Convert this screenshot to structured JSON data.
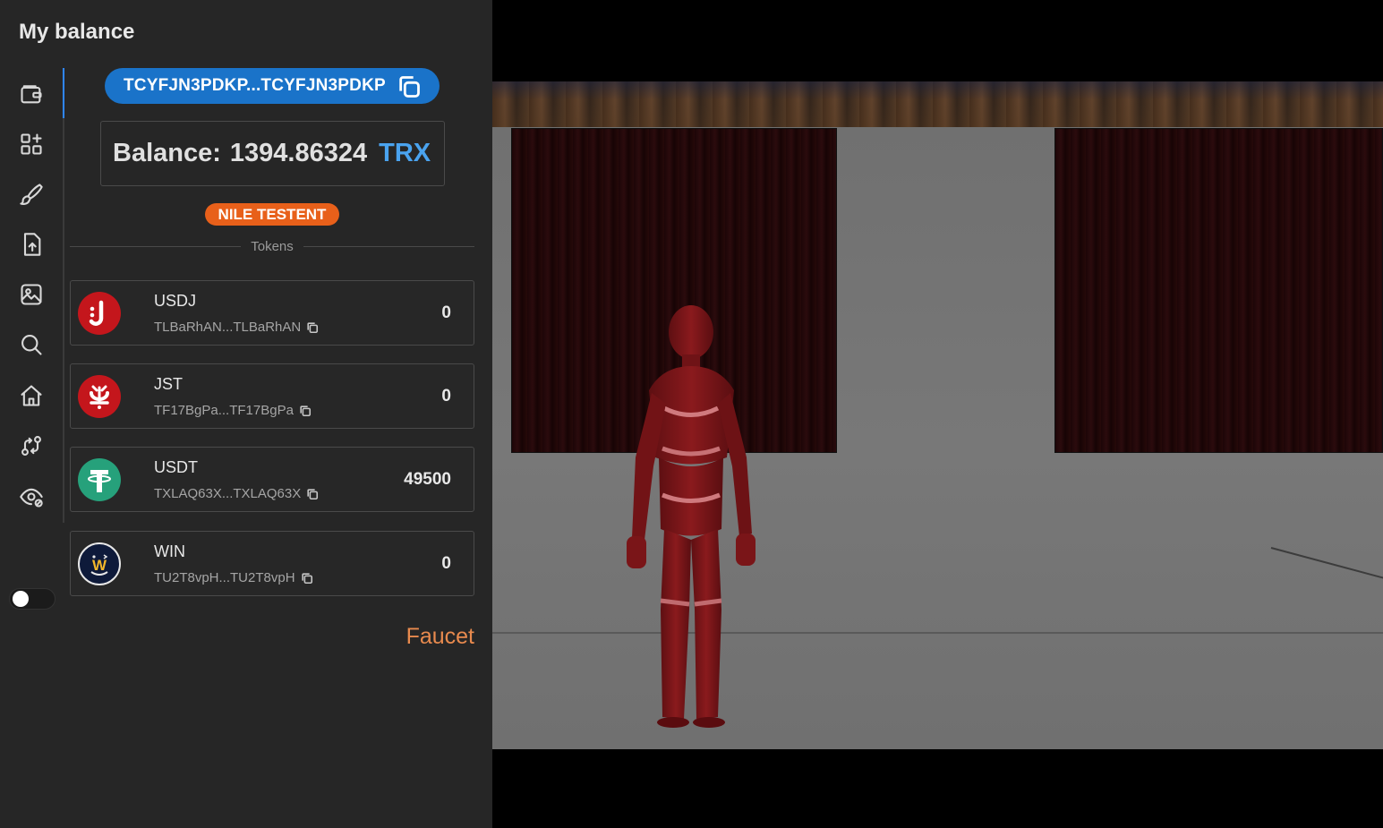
{
  "panel": {
    "title": "My balance",
    "address": "TCYFJN3PDKP...TCYFJN3PDKP",
    "balance_label": "Balance:",
    "balance_value": "1394.86324",
    "balance_unit": "TRX",
    "network": "NILE TESTENT",
    "tokens_heading": "Tokens",
    "faucet_label": "Faucet"
  },
  "nav": {
    "items": [
      {
        "icon": "wallet-icon"
      },
      {
        "icon": "apps-add-icon"
      },
      {
        "icon": "brush-icon"
      },
      {
        "icon": "file-upload-icon"
      },
      {
        "icon": "image-icon"
      },
      {
        "icon": "search-icon"
      },
      {
        "icon": "home-icon"
      },
      {
        "icon": "swap-icon"
      },
      {
        "icon": "eye-settings-icon"
      }
    ],
    "active_index": 0,
    "theme_toggle": "off"
  },
  "tokens": [
    {
      "name": "USDJ",
      "address": "TLBaRhAN...TLBaRhAN",
      "amount": "0",
      "logo": "usdj-logo",
      "color": "#c4161c"
    },
    {
      "name": "JST",
      "address": "TF17BgPa...TF17BgPa",
      "amount": "0",
      "logo": "jst-logo",
      "color": "#c4161c"
    },
    {
      "name": "USDT",
      "address": "TXLAQ63X...TXLAQ63X",
      "amount": "49500",
      "logo": "usdt-logo",
      "color": "#26a17b"
    },
    {
      "name": "WIN",
      "address": "TU2T8vpH...TU2T8vpH",
      "amount": "0",
      "logo": "win-logo",
      "color": "#0e1a3a"
    }
  ],
  "colors": {
    "panel_bg": "#262626",
    "accent_blue": "#1a73c9",
    "trx_blue": "#4aa3ef",
    "network_orange": "#e8601a",
    "faucet_orange": "#e88a4e"
  }
}
